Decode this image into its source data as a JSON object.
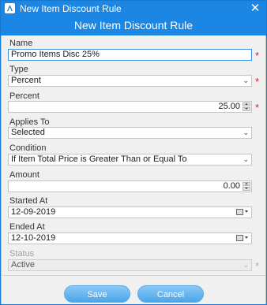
{
  "window": {
    "title": "New Item Discount Rule",
    "close_symbol": "✕"
  },
  "header": {
    "title": "New Item Discount Rule"
  },
  "fields": {
    "name": {
      "label": "Name",
      "value": "Promo Items Disc 25%",
      "required": true
    },
    "type": {
      "label": "Type",
      "value": "Percent",
      "required": true
    },
    "percent": {
      "label": "Percent",
      "value": "25.00",
      "required": true
    },
    "applies_to": {
      "label": "Applies To",
      "value": "Selected"
    },
    "condition": {
      "label": "Condition",
      "value": "If Item Total Price is Greater Than or Equal To"
    },
    "amount": {
      "label": "Amount",
      "value": "0.00"
    },
    "started_at": {
      "label": "Started At",
      "value": "12-09-2019"
    },
    "ended_at": {
      "label": "Ended At",
      "value": "12-10-2019"
    },
    "status": {
      "label": "Status",
      "value": "Active",
      "required": true,
      "disabled": true
    }
  },
  "required_marker": "*",
  "buttons": {
    "save": "Save",
    "cancel": "Cancel"
  },
  "colors": {
    "titlebar": "#1b86e3",
    "focus_border": "#3a8ee6",
    "required": "#e02020",
    "button": "#4aa6ea"
  }
}
